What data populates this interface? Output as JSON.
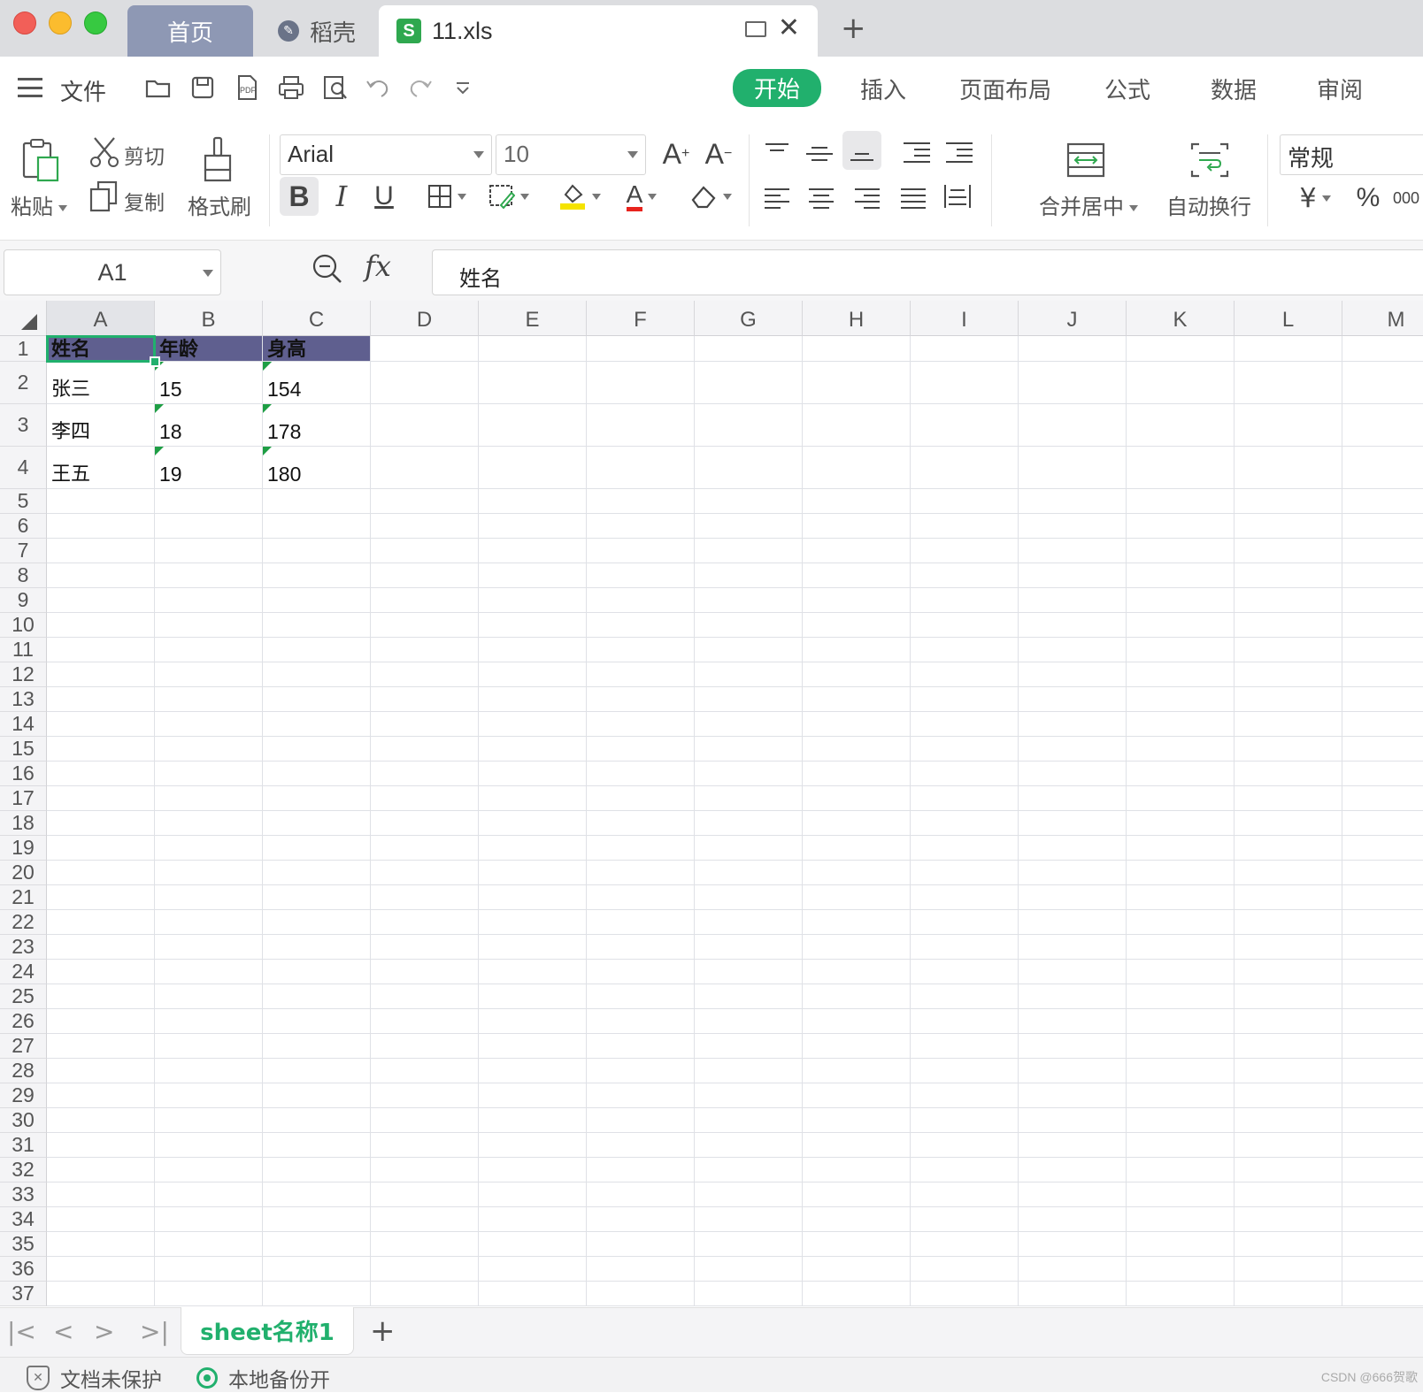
{
  "window": {
    "tabs": [
      {
        "label": "首页"
      },
      {
        "label": "稻壳"
      },
      {
        "label": "11.xls"
      }
    ]
  },
  "menu": {
    "file_label": "文件",
    "tabs": [
      "开始",
      "插入",
      "页面布局",
      "公式",
      "数据",
      "审阅"
    ],
    "active_tab": "开始"
  },
  "ribbon": {
    "paste": "粘贴",
    "cut": "剪切",
    "copy": "复制",
    "format_painter": "格式刷",
    "font_name": "Arial",
    "font_size": "10",
    "merge_center": "合并居中",
    "wrap_text": "自动换行",
    "number_format": "常规",
    "currency_symbol": "¥",
    "percent_symbol": "%",
    "thousands_symbol": "000"
  },
  "formula_bar": {
    "cell_ref": "A1",
    "fx": "fx",
    "content": "姓名"
  },
  "grid": {
    "columns": [
      "A",
      "B",
      "C",
      "D",
      "E",
      "F",
      "G",
      "H",
      "I",
      "J",
      "K",
      "L",
      "M"
    ],
    "selected_column": "A",
    "rows": [
      [
        "姓名",
        "年龄",
        "身高"
      ],
      [
        "张三",
        "15",
        "154"
      ],
      [
        "李四",
        "18",
        "178"
      ],
      [
        "王五",
        "19",
        "180"
      ]
    ],
    "row_count": 37,
    "header_fill_color": "#5f5f8f",
    "selection_color": "#21b06d"
  },
  "sheets": {
    "tabs": [
      "sheet名称1"
    ],
    "add_label": "+"
  },
  "status": {
    "protection": "文档未保护",
    "backup": "本地备份开",
    "watermark": "CSDN @666贺歌"
  }
}
